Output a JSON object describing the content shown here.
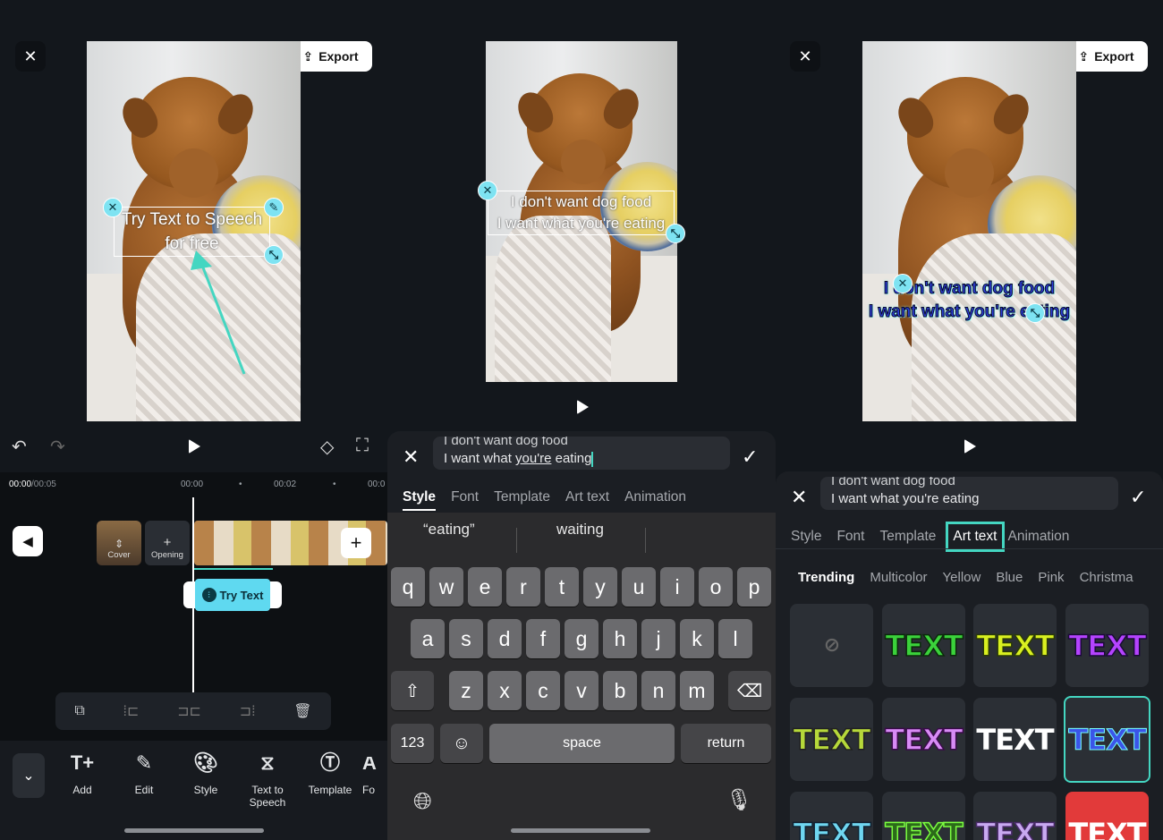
{
  "editor": {
    "close_icon": "close-icon",
    "export_label": "Export",
    "canvas_text_line1": "Try Text to Speech",
    "canvas_text_line2": "for free",
    "time_current": "00:00",
    "time_total": "/00:05",
    "ruler": [
      "00:00",
      "00:02",
      "00:0"
    ],
    "cover_label": "Cover",
    "opening_label": "Opening",
    "text_clip_label": "Try Text",
    "toolbar": [
      {
        "icon": "add-text-icon",
        "label": "Add"
      },
      {
        "icon": "edit-icon",
        "label": "Edit"
      },
      {
        "icon": "palette-icon",
        "label": "Style"
      },
      {
        "icon": "text-to-speech-icon",
        "label": "Text to Speech"
      },
      {
        "icon": "template-icon",
        "label": "Template"
      },
      {
        "icon": "font-icon",
        "label": "Fo"
      }
    ],
    "accent_color": "#44d6c1"
  },
  "typing": {
    "canvas_text_line1": "I don't want dog food",
    "canvas_text_line2": "I want what you're eating",
    "input_line1": "I don't want dog food",
    "input_line2_a": "I want what ",
    "input_line2_b": "you're",
    "input_line2_c": " eating",
    "tabs": [
      "Style",
      "Font",
      "Template",
      "Art text",
      "Animation"
    ],
    "active_tab": "Style",
    "suggestions": [
      "“eating”",
      "waiting"
    ],
    "keyboard": {
      "row1": [
        "q",
        "w",
        "e",
        "r",
        "t",
        "y",
        "u",
        "i",
        "o",
        "p"
      ],
      "row2": [
        "a",
        "s",
        "d",
        "f",
        "g",
        "h",
        "j",
        "k",
        "l"
      ],
      "row3": [
        "z",
        "x",
        "c",
        "v",
        "b",
        "n",
        "m"
      ],
      "numbers": "123",
      "space": "space",
      "return": "return"
    }
  },
  "arttext": {
    "canvas_text_line1": "I don't want dog food",
    "canvas_text_line2": "I want what you're eating",
    "export_label": "Export",
    "input_line1": "I don't want dog food",
    "input_line2": "I want what you're eating",
    "tabs": [
      "Style",
      "Font",
      "Template",
      "Art text",
      "Animation"
    ],
    "active_tab": "Art text",
    "categories": [
      "Trending",
      "Multicolor",
      "Yellow",
      "Blue",
      "Pink",
      "Christma"
    ],
    "active_category": "Trending",
    "preset_text": "TEXT",
    "preset_none_icon": "ban-icon",
    "selected_preset_index": 7
  }
}
